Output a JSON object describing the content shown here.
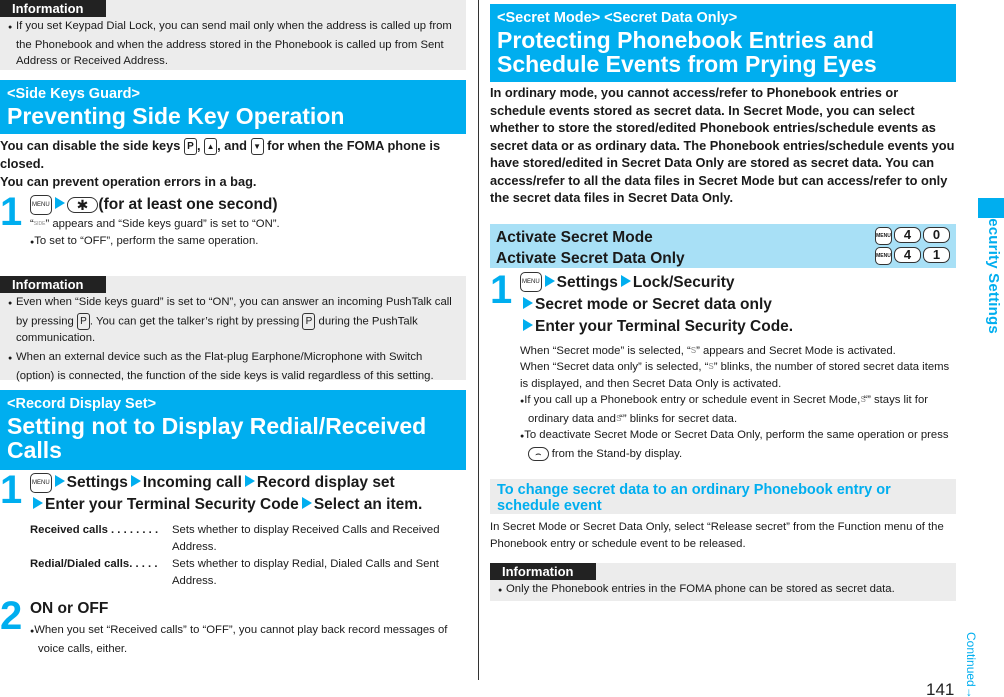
{
  "info1": {
    "tag": "Information",
    "items": [
      "If you set Keypad Dial Lock, you can send mail only when the address is called up from the Phonebook and when the address stored in the Phonebook is called up from Sent Address or Received Address."
    ]
  },
  "side_keys": {
    "subtitle": "<Side Keys Guard>",
    "title": "Preventing Side Key Operation",
    "lead_1a": "You can disable the side keys",
    "lead_1b": ",",
    "lead_1c": ", and",
    "lead_1d": "for when the FOMA phone is closed.",
    "lead_2": "You can prevent operation errors in a bag.",
    "step1": {
      "number": "1",
      "key_menu": "MENU",
      "key_star": "✱",
      "text": "(for at least one second)",
      "note_a": "“",
      "note_b": "” appears and “Side keys guard” is set to “ON”.",
      "bullet": "To set to “OFF”, perform the same operation."
    }
  },
  "info2": {
    "tag": "Information",
    "item1_a": "Even when “Side keys guard” is set to “ON”, you can answer an incoming PushTalk call by pressing",
    "item1_b": ". You can get the talker’s right by pressing",
    "item1_c": "during the PushTalk communication.",
    "item2": "When an external device such as the Flat-plug Earphone/Microphone with Switch (option) is connected, the function of the side keys is valid regardless of this setting."
  },
  "record_display": {
    "subtitle": "<Record Display Set>",
    "title": "Setting not to Display Redial/Received Calls",
    "step1": {
      "number": "1",
      "key_menu": "MENU",
      "path": [
        "Settings",
        "Incoming call",
        "Record display set"
      ],
      "path2": [
        "Enter your Terminal Security Code",
        "Select an item."
      ]
    },
    "definitions": [
      {
        "term": "Received calls . . . . . . . .",
        "desc": "Sets whether to display Received Calls and Received Address."
      },
      {
        "term": "Redial/Dialed calls. . . . .",
        "desc": "Sets whether to display Redial, Dialed Calls and Sent Address."
      }
    ],
    "step2": {
      "number": "2",
      "text": "ON or OFF",
      "bullet": "When you set “Received calls” to “OFF”, you cannot play back record messages of voice calls, either."
    }
  },
  "secret": {
    "subtitle": "<Secret Mode> <Secret Data Only>",
    "title": "Protecting Phonebook Entries and Schedule Events from Prying Eyes",
    "lead": "In ordinary mode, you cannot access/refer to Phonebook entries or schedule events stored as secret data. In Secret Mode, you can select whether to store the stored/edited Phonebook entries/schedule events as secret data or as ordinary data. The Phonebook entries/schedule events you have stored/edited in Secret Data Only are stored as secret data. You can access/refer to all the data files in Secret Mode but can access/refer to only the secret data files in Secret Data Only.",
    "activate": [
      {
        "label": "Activate Secret Mode",
        "keys": [
          "MENU",
          "4",
          "0"
        ]
      },
      {
        "label": "Activate Secret Data Only",
        "keys": [
          "MENU",
          "4",
          "1"
        ]
      }
    ],
    "step1": {
      "number": "1",
      "key_menu": "MENU",
      "path": [
        "Settings",
        "Lock/Security"
      ],
      "line2": "Secret mode or Secret data only",
      "line3": "Enter your Terminal Security Code."
    },
    "note1_a": "When “Secret mode” is selected, “",
    "note1_b": "” appears and Secret Mode is activated.",
    "note2_a": "When “Secret data only” is selected, “",
    "note2_b": "” blinks, the number of stored secret data items is displayed, and then Secret Data Only is activated.",
    "bullet1_a": "If you call up a Phonebook entry or schedule event in Secret Mode, “",
    "bullet1_b": "” stays lit for ordinary data and “",
    "bullet1_c": "” blinks for secret data.",
    "bullet2_a": "To deactivate Secret Mode or Secret Data Only, perform the same operation or press",
    "bullet2_b": "from the Stand-by display.",
    "change_heading": "To change secret data to an ordinary Phonebook entry or schedule event",
    "change_text": "In Secret Mode or Secret Data Only, select “Release secret” from the Function menu of the Phonebook entry or schedule event to be released.",
    "info": {
      "tag": "Information",
      "items": [
        "Only the Phonebook entries in the FOMA phone can be stored as secret data."
      ]
    }
  },
  "sidebar": {
    "section_title": "Security Settings",
    "continued": "Continued",
    "continued_arrow": "→",
    "page_number": "141"
  },
  "icons": {
    "bullet": "●",
    "side_key": "P",
    "up_key": "▲",
    "down_key": "▼",
    "guard_icon": "SIDE",
    "secret_icon": "S",
    "end_key": "⌢"
  }
}
